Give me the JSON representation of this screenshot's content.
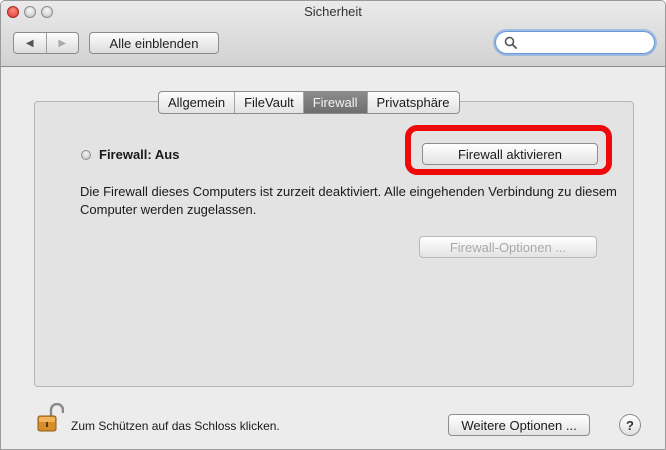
{
  "window": {
    "title": "Sicherheit"
  },
  "toolbar": {
    "back_icon": "back-arrow-icon",
    "forward_icon": "forward-arrow-icon",
    "show_all_label": "Alle einblenden",
    "search_placeholder": ""
  },
  "tabs": [
    {
      "label": "Allgemein",
      "active": false
    },
    {
      "label": "FileVault",
      "active": false
    },
    {
      "label": "Firewall",
      "active": true
    },
    {
      "label": "Privatsphäre",
      "active": false
    }
  ],
  "firewall": {
    "status_label": "Firewall: Aus",
    "activate_button": "Firewall aktivieren",
    "description": "Die Firewall dieses Computers ist zurzeit deaktiviert. Alle eingehenden Verbindung zu diesem Computer werden zugelassen.",
    "options_button": "Firewall-Optionen ..."
  },
  "footer": {
    "lock_text": "Zum Schützen auf das Schloss klicken.",
    "more_options_button": "Weitere Optionen ...",
    "help_label": "?"
  },
  "colors": {
    "highlight": "#ee0a0a",
    "active_tab": "#7d7d7d",
    "search_focus": "#6a9ad6"
  }
}
